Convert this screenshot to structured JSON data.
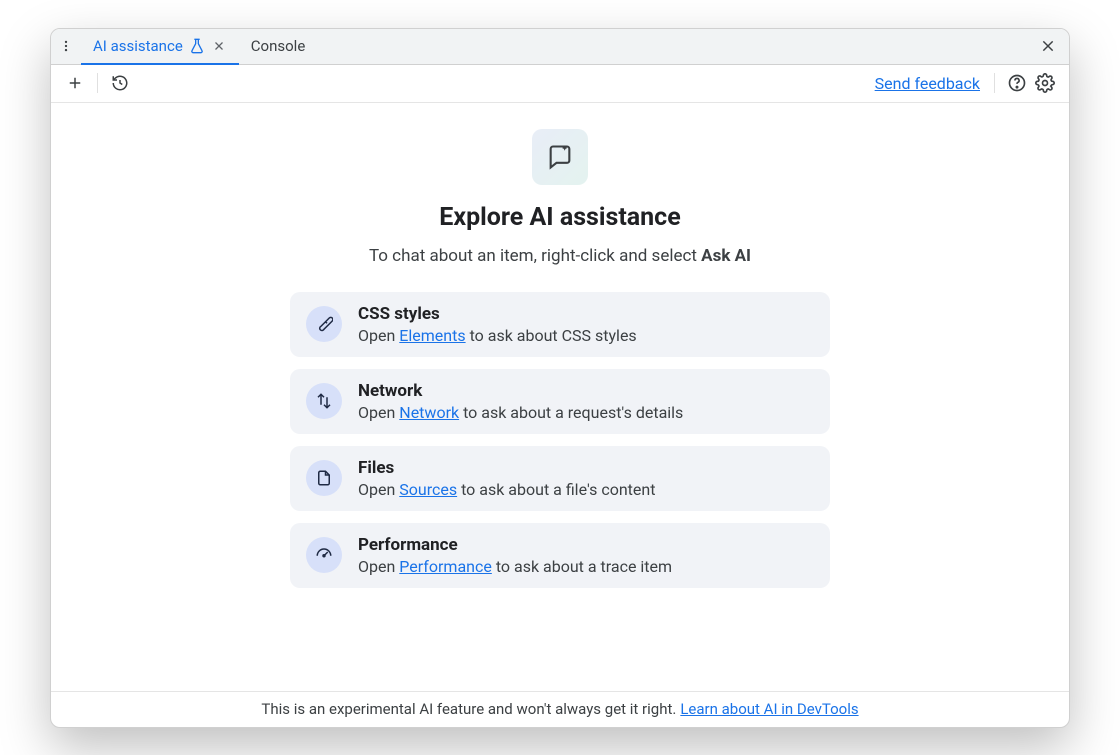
{
  "tabs": {
    "active": "AI assistance",
    "inactive": "Console"
  },
  "toolbar": {
    "feedback_link": "Send feedback"
  },
  "hero": {
    "title": "Explore AI assistance",
    "subtitle_prefix": "To chat about an item, right-click and select ",
    "subtitle_bold": "Ask AI"
  },
  "cards": [
    {
      "icon": "brush",
      "title": "CSS styles",
      "prefix": "Open ",
      "link": "Elements",
      "suffix": " to ask about CSS styles"
    },
    {
      "icon": "swap",
      "title": "Network",
      "prefix": "Open ",
      "link": "Network",
      "suffix": " to ask about a request's details"
    },
    {
      "icon": "file",
      "title": "Files",
      "prefix": "Open ",
      "link": "Sources",
      "suffix": " to ask about a file's content"
    },
    {
      "icon": "gauge",
      "title": "Performance",
      "prefix": "Open ",
      "link": "Performance",
      "suffix": " to ask about a trace item"
    }
  ],
  "footer": {
    "text": "This is an experimental AI feature and won't always get it right.",
    "link": "Learn about AI in DevTools"
  }
}
